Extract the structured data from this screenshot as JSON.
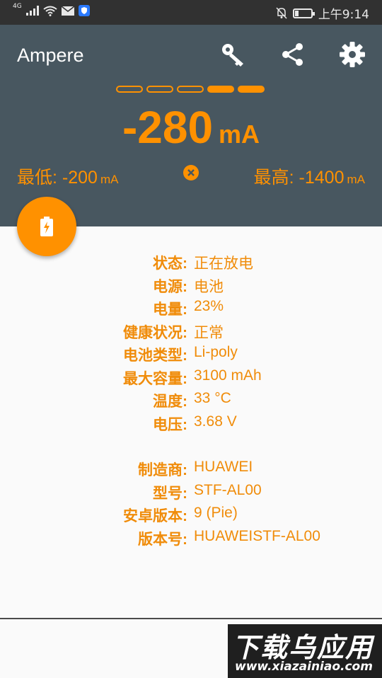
{
  "statusbar": {
    "network_tag": "4G",
    "time": "上午9:14",
    "battery_level": 0.23
  },
  "header": {
    "title": "Ampere"
  },
  "meter": {
    "dashes": [
      false,
      false,
      false,
      true,
      true
    ],
    "current_value": "-280",
    "current_unit": "mA",
    "min_label": "最低: -200",
    "min_unit": "mA",
    "max_label": "最高: -1400",
    "max_unit": "mA"
  },
  "colors": {
    "accent": "#ff9100",
    "header_bg": "#485760",
    "statusbar_bg": "#313131"
  },
  "info_rows": [
    {
      "key": "状态:",
      "value": "正在放电"
    },
    {
      "key": "电源:",
      "value": "电池"
    },
    {
      "key": "电量:",
      "value": "23%"
    },
    {
      "key": "健康状况:",
      "value": "正常"
    },
    {
      "key": "电池类型:",
      "value": "Li-poly"
    },
    {
      "key": "最大容量:",
      "value": "3100 mAh"
    },
    {
      "key": "温度:",
      "value": "33 °C"
    },
    {
      "key": "电压:",
      "value": "3.68 V"
    }
  ],
  "device_rows": [
    {
      "key": "制造商:",
      "value": "HUAWEI"
    },
    {
      "key": "型号:",
      "value": "STF-AL00"
    },
    {
      "key": "安卓版本:",
      "value": "9 (Pie)"
    },
    {
      "key": "版本号:",
      "value": "HUAWEISTF-AL00"
    }
  ],
  "watermark": {
    "main": "下载乌应用",
    "sub": "www.xiazainiao.com"
  },
  "icons": {
    "toolbar": [
      "key-icon",
      "share-icon",
      "gear-icon"
    ],
    "fab": "battery-charging-icon",
    "reset": "close-circle-icon"
  }
}
